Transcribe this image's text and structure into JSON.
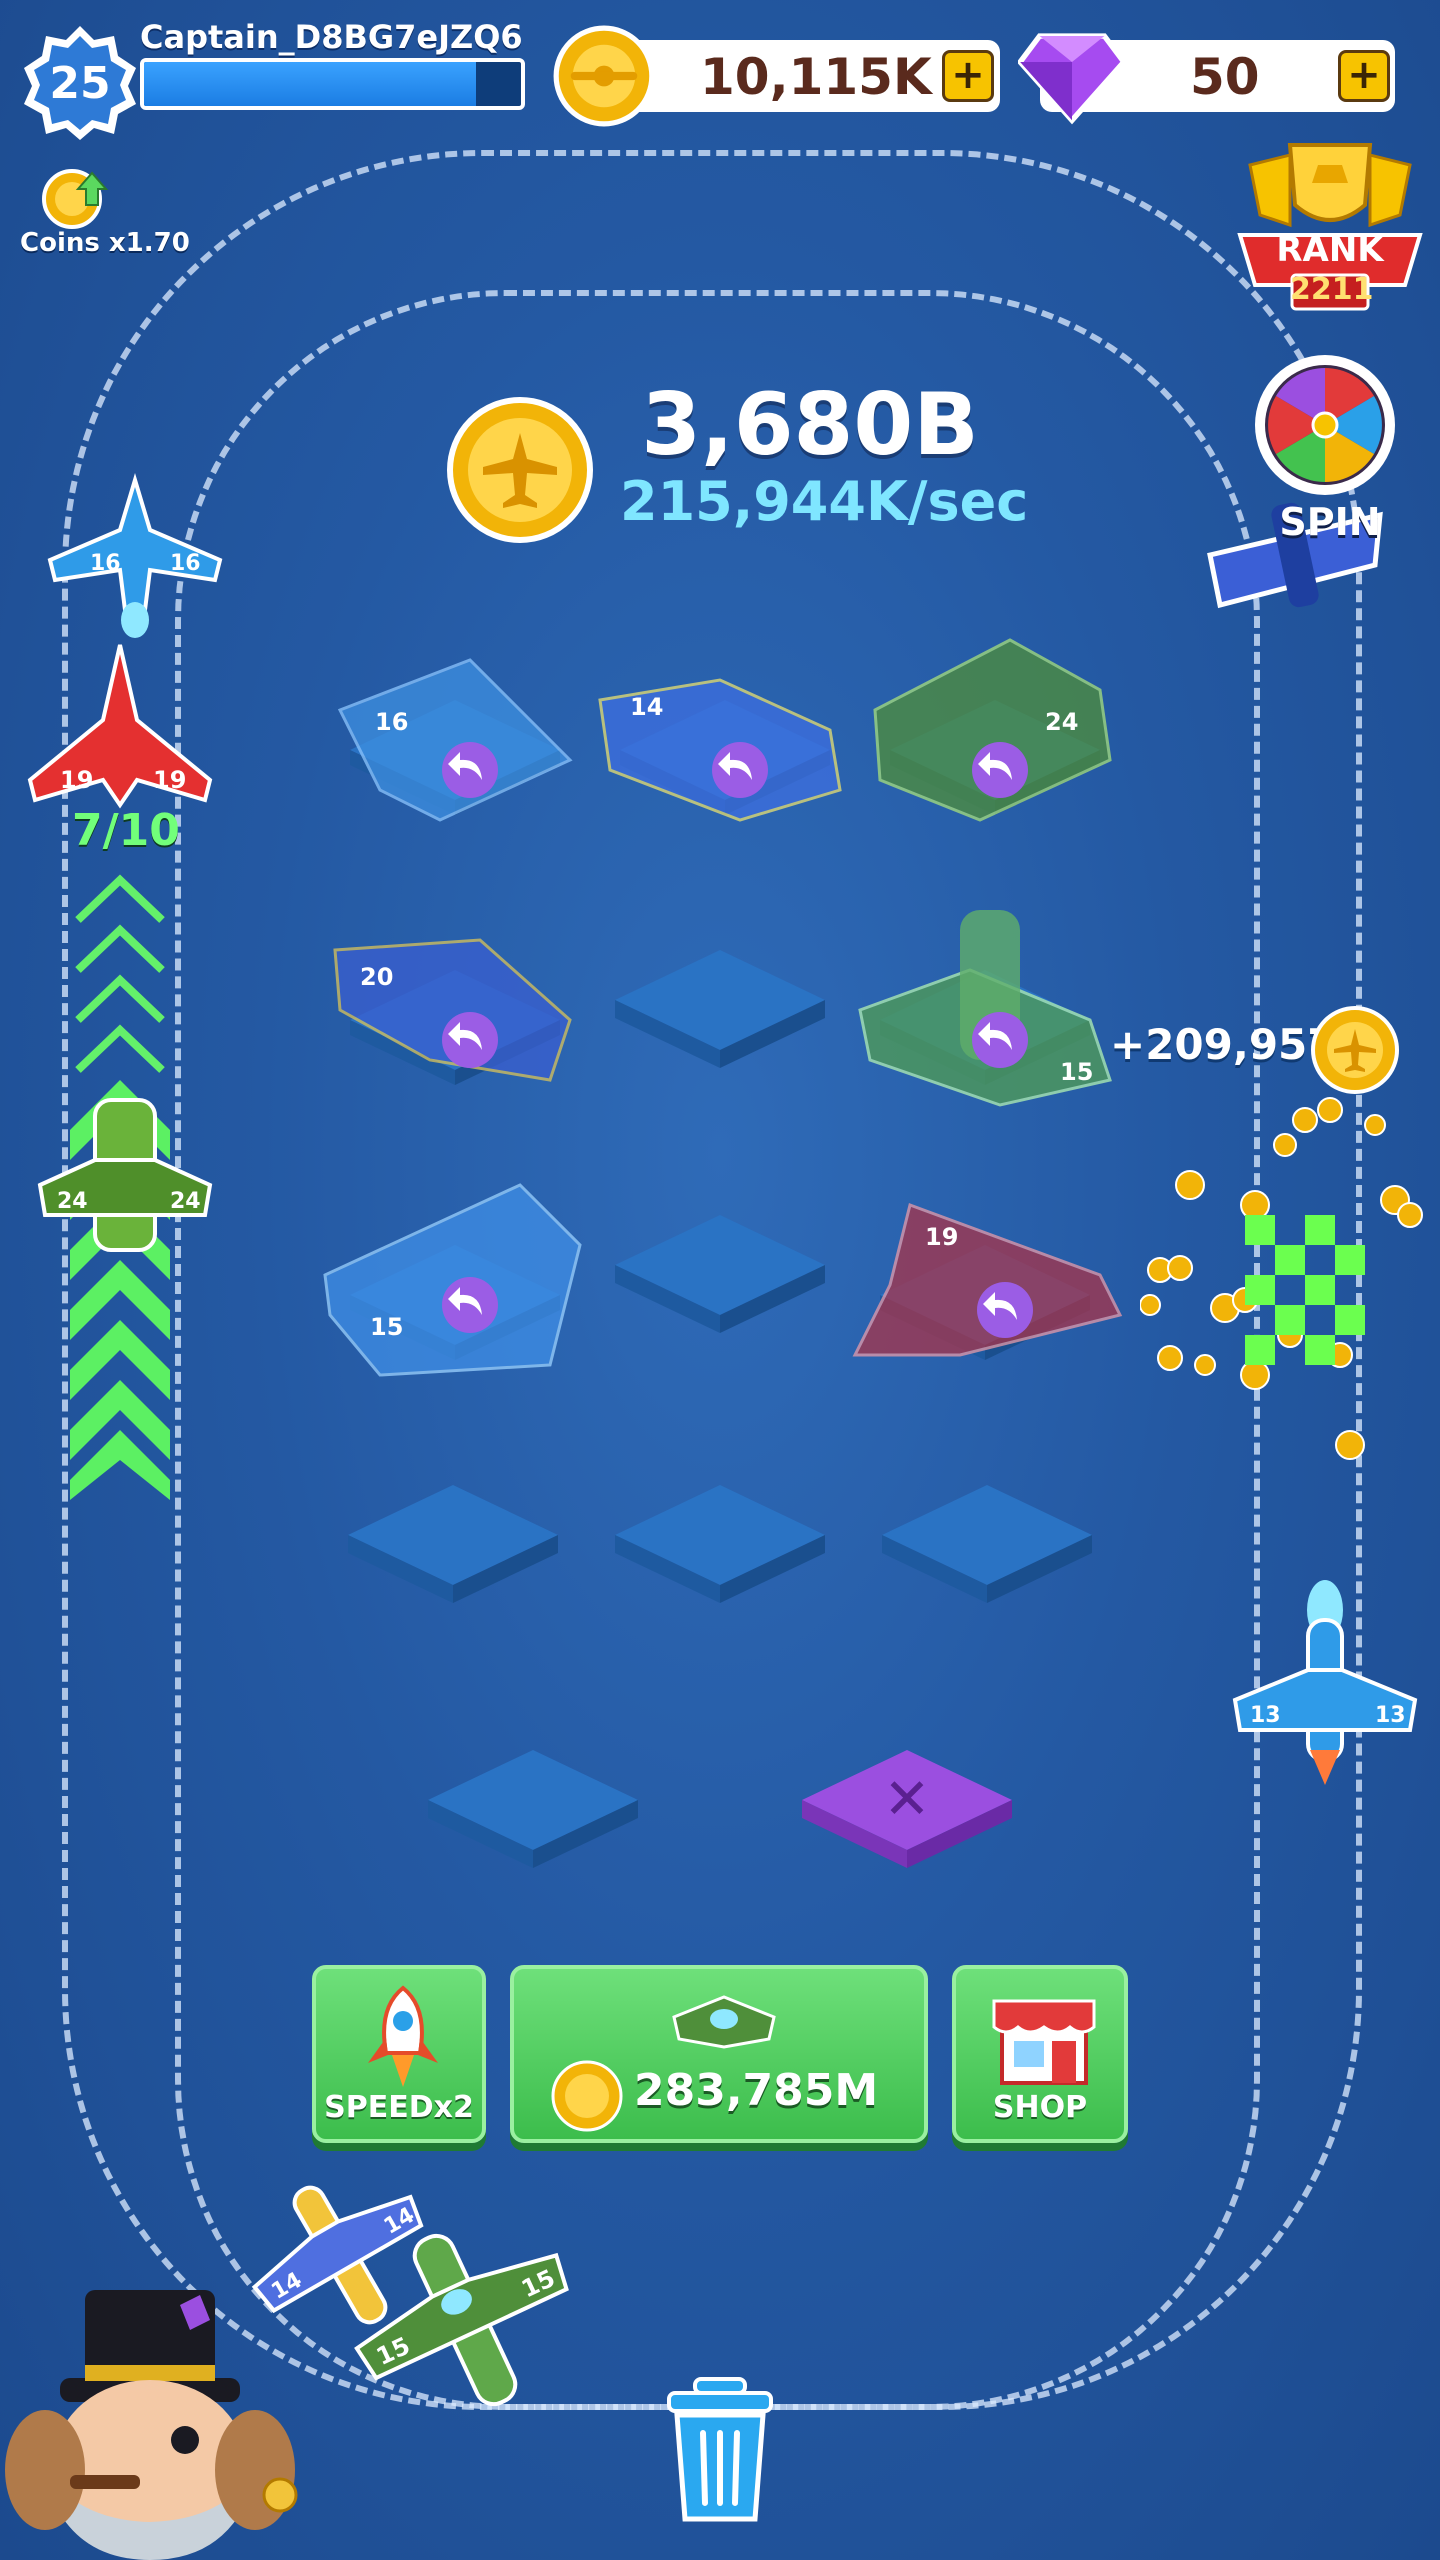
{
  "player": {
    "level": "25",
    "name": "Captain_D8BG7eJZQ6",
    "xp_fraction": 0.88
  },
  "resources": {
    "coins": "10,115K",
    "gems": "50",
    "plus": "+"
  },
  "boost": {
    "label": "Coins x1.70"
  },
  "earnings": {
    "total": "3,680B",
    "rate": "215,944K/sec"
  },
  "rank": {
    "label": "RANK",
    "value": "2211"
  },
  "spin": {
    "label": "SPIN"
  },
  "runway": {
    "plane_count": "7/10"
  },
  "popup": {
    "reward": "+209,957"
  },
  "planes": {
    "track_left_1": "16",
    "track_left_2": "19",
    "track_left_3": "24",
    "track_right": "13",
    "track_bottom_1": "14",
    "track_bottom_2": "15",
    "grid_r1c1": "16",
    "grid_r1c2": "14",
    "grid_r1c3": "24",
    "grid_r2c1": "20",
    "grid_r2c3": "15",
    "grid_r3c1": "15",
    "grid_r3c3": "19"
  },
  "buttons": {
    "speed": "SPEEDx2",
    "buy_price": "283,785M",
    "shop": "SHOP",
    "delete": "✕"
  },
  "colors": {
    "background": "#2459a3",
    "tile": "#2a73c4",
    "delete_tile": "#9b4fe0",
    "button_green": "#4cc95a",
    "gold": "#f6b80e",
    "accent_cyan": "#7fe6ff"
  }
}
